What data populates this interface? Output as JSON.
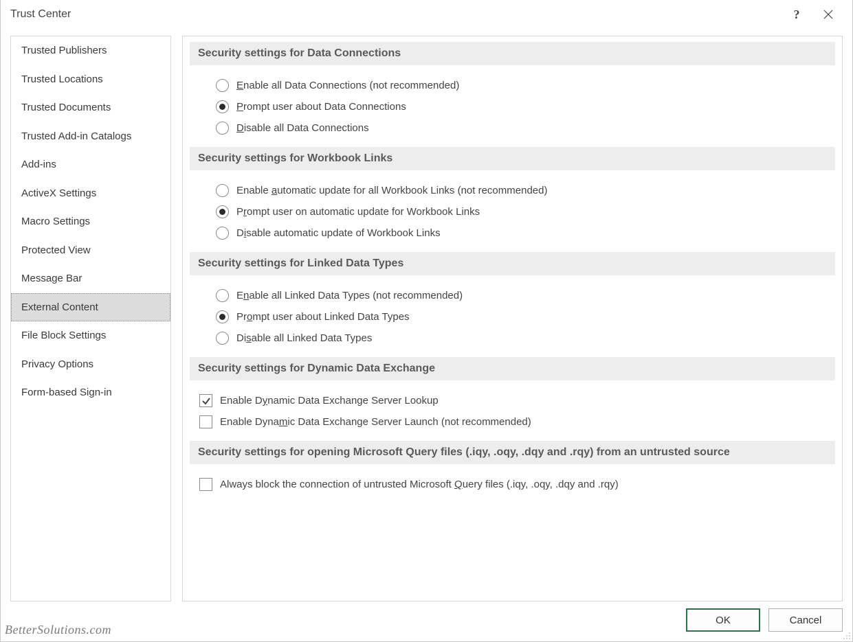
{
  "window": {
    "title": "Trust Center"
  },
  "sidebar": {
    "items": [
      {
        "label": "Trusted Publishers",
        "name": "sidebar-item-trusted-publishers"
      },
      {
        "label": "Trusted Locations",
        "name": "sidebar-item-trusted-locations"
      },
      {
        "label": "Trusted Documents",
        "name": "sidebar-item-trusted-documents"
      },
      {
        "label": "Trusted Add-in Catalogs",
        "name": "sidebar-item-trusted-addin-catalogs"
      },
      {
        "label": "Add-ins",
        "name": "sidebar-item-add-ins"
      },
      {
        "label": "ActiveX Settings",
        "name": "sidebar-item-activex-settings"
      },
      {
        "label": "Macro Settings",
        "name": "sidebar-item-macro-settings"
      },
      {
        "label": "Protected View",
        "name": "sidebar-item-protected-view"
      },
      {
        "label": "Message Bar",
        "name": "sidebar-item-message-bar"
      },
      {
        "label": "External Content",
        "name": "sidebar-item-external-content",
        "selected": true
      },
      {
        "label": "File Block Settings",
        "name": "sidebar-item-file-block-settings"
      },
      {
        "label": "Privacy Options",
        "name": "sidebar-item-privacy-options"
      },
      {
        "label": "Form-based Sign-in",
        "name": "sidebar-item-form-based-sign-in"
      }
    ]
  },
  "sections": {
    "data_connections": {
      "header": "Security settings for Data Connections",
      "options": [
        {
          "html": "<u>E</u>nable all Data Connections (not recommended)",
          "checked": false,
          "name": "radio-enable-all-data-connections"
        },
        {
          "html": "<u>P</u>rompt user about Data Connections",
          "checked": true,
          "name": "radio-prompt-data-connections"
        },
        {
          "html": "<u>D</u>isable all Data Connections",
          "checked": false,
          "name": "radio-disable-all-data-connections"
        }
      ]
    },
    "workbook_links": {
      "header": "Security settings for Workbook Links",
      "options": [
        {
          "html": "Enable <u>a</u>utomatic update for all Workbook Links (not recommended)",
          "checked": false,
          "name": "radio-enable-auto-workbook-links"
        },
        {
          "html": "P<u>r</u>ompt user on automatic update for Workbook Links",
          "checked": true,
          "name": "radio-prompt-workbook-links"
        },
        {
          "html": "D<u>i</u>sable automatic update of Workbook Links",
          "checked": false,
          "name": "radio-disable-workbook-links"
        }
      ]
    },
    "linked_data_types": {
      "header": "Security settings for Linked Data Types",
      "options": [
        {
          "html": "E<u>n</u>able all Linked Data Types (not recommended)",
          "checked": false,
          "name": "radio-enable-linked-data-types"
        },
        {
          "html": "Pr<u>o</u>mpt user about Linked Data Types",
          "checked": true,
          "name": "radio-prompt-linked-data-types"
        },
        {
          "html": "Di<u>s</u>able all Linked Data Types",
          "checked": false,
          "name": "radio-disable-linked-data-types"
        }
      ]
    },
    "dde": {
      "header": "Security settings for Dynamic Data Exchange",
      "options": [
        {
          "html": "Enable D<u>y</u>namic Data Exchange Server Lookup",
          "checked": true,
          "name": "check-dde-server-lookup"
        },
        {
          "html": "Enable Dyna<u>m</u>ic Data Exchange Server Launch (not recommended)",
          "checked": false,
          "name": "check-dde-server-launch"
        }
      ]
    },
    "query_files": {
      "header": "Security settings for opening  Microsoft Query files (.iqy, .oqy, .dqy and .rqy) from an untrusted source",
      "options": [
        {
          "html": "Always block the connection of untrusted Microsoft <u>Q</u>uery files (.iqy, .oqy, .dqy and .rqy)",
          "checked": false,
          "name": "check-block-untrusted-query-files"
        }
      ]
    }
  },
  "footer": {
    "ok": "OK",
    "cancel": "Cancel"
  },
  "watermark": "BetterSolutions.com"
}
